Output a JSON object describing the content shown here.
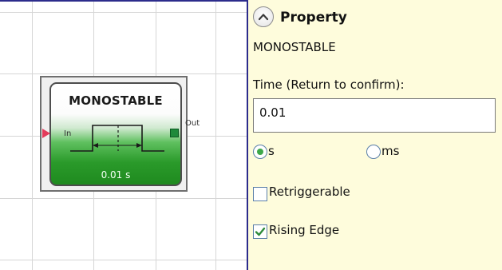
{
  "canvas": {
    "block": {
      "title": "MONOSTABLE",
      "value": "0.01 s",
      "input_port_label": "In",
      "output_port_label": "Out"
    }
  },
  "panel": {
    "title": "Property",
    "block_name": "MONOSTABLE",
    "time_label": "Time (Return to confirm):",
    "time_value": "0.01",
    "units": [
      {
        "label": "s",
        "selected": true
      },
      {
        "label": "ms",
        "selected": false
      }
    ],
    "options": [
      {
        "label": "Retriggerable",
        "checked": false
      },
      {
        "label": "Rising Edge",
        "checked": true
      }
    ]
  },
  "colors": {
    "panel_background": "#fefcdc",
    "block_green": "#2a9a2a",
    "input_port": "#e33b5b",
    "output_port": "#1f8a3a",
    "divider": "#2c2c8c"
  }
}
